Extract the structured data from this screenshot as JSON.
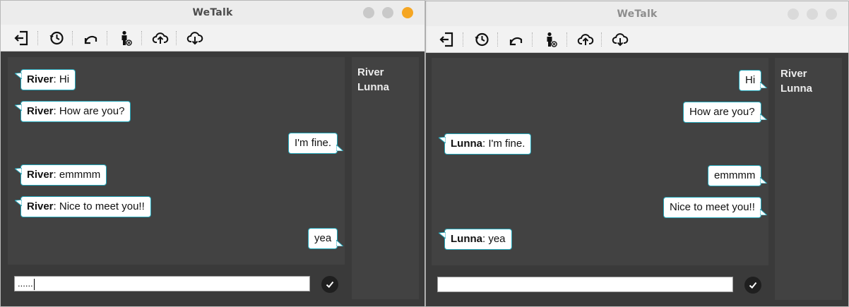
{
  "windows": [
    {
      "title": "WeTalk",
      "active": true,
      "users": [
        "River",
        "Lunna"
      ],
      "messages": [
        {
          "dir": "in",
          "sender": "River",
          "text": "Hi"
        },
        {
          "dir": "in",
          "sender": "River",
          "text": "How are you?"
        },
        {
          "dir": "out",
          "sender": "",
          "text": "I'm fine."
        },
        {
          "dir": "in",
          "sender": "River",
          "text": "emmmm"
        },
        {
          "dir": "in",
          "sender": "River",
          "text": "Nice to meet you!!"
        },
        {
          "dir": "out",
          "sender": "",
          "text": "yea"
        }
      ],
      "input_value": "......"
    },
    {
      "title": "WeTalk",
      "active": false,
      "users": [
        "River",
        "Lunna"
      ],
      "messages": [
        {
          "dir": "out",
          "sender": "",
          "text": "Hi"
        },
        {
          "dir": "out",
          "sender": "",
          "text": "How are you?"
        },
        {
          "dir": "in",
          "sender": "Lunna",
          "text": "I'm fine."
        },
        {
          "dir": "out",
          "sender": "",
          "text": "emmmm"
        },
        {
          "dir": "out",
          "sender": "",
          "text": "Nice to meet you!!"
        },
        {
          "dir": "in",
          "sender": "Lunna",
          "text": "yea"
        }
      ],
      "input_value": ""
    }
  ],
  "toolbar_icons": [
    "logout-icon",
    "history-icon",
    "undo-icon",
    "user-status-icon",
    "upload-icon",
    "download-icon"
  ],
  "colors": {
    "bubble_border": "#23a5b8",
    "panel_bg": "#424242",
    "close_button": "#f5a623"
  }
}
